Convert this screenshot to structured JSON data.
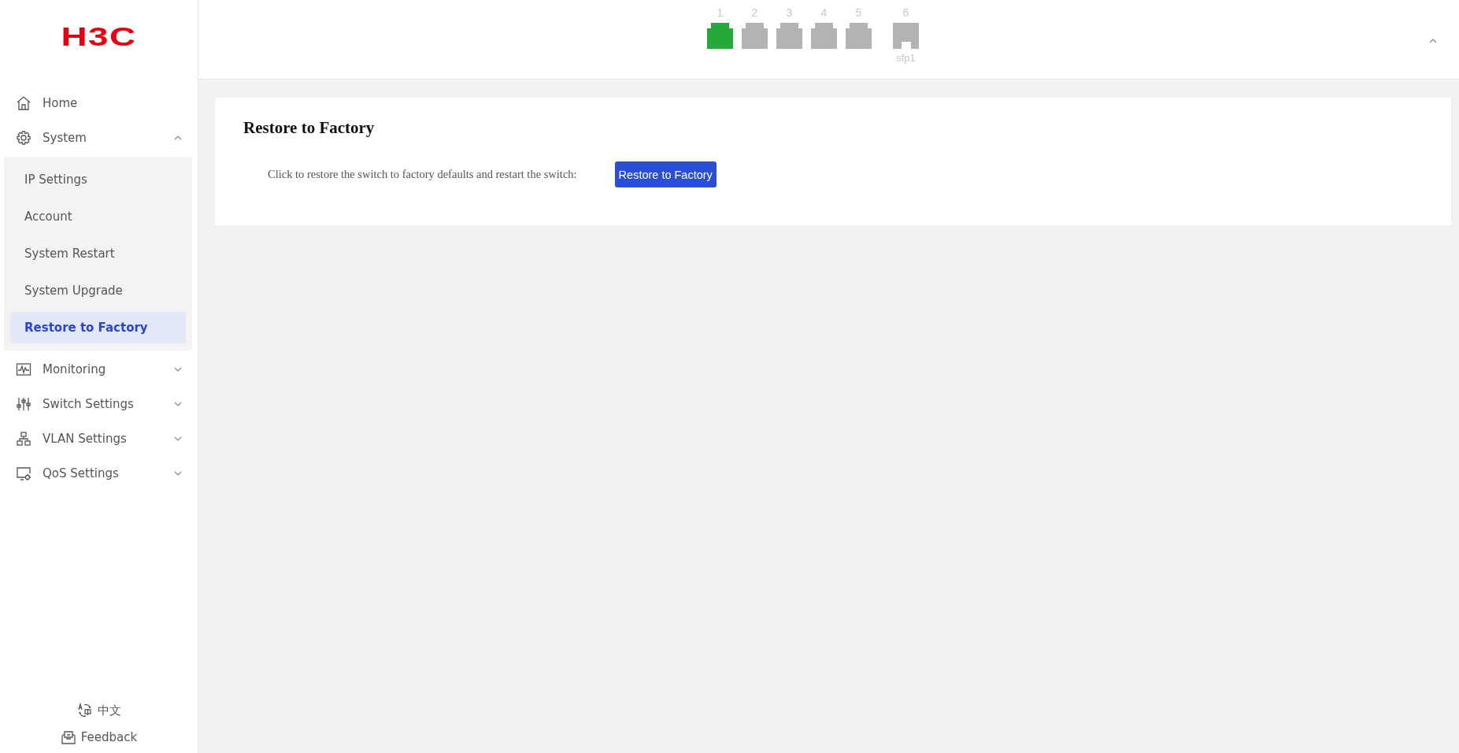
{
  "logo": {
    "text": "H3C"
  },
  "sidebar": {
    "items": [
      {
        "label": "Home",
        "kind": "link"
      },
      {
        "label": "System",
        "kind": "group",
        "expanded": true,
        "children": [
          {
            "label": "IP Settings",
            "selected": false
          },
          {
            "label": "Account",
            "selected": false
          },
          {
            "label": "System Restart",
            "selected": false
          },
          {
            "label": "System Upgrade",
            "selected": false
          },
          {
            "label": "Restore to Factory",
            "selected": true
          }
        ]
      },
      {
        "label": "Monitoring",
        "kind": "group",
        "expanded": false
      },
      {
        "label": "Switch Settings",
        "kind": "group",
        "expanded": false
      },
      {
        "label": "VLAN Settings",
        "kind": "group",
        "expanded": false
      },
      {
        "label": "QoS Settings",
        "kind": "group",
        "expanded": false
      }
    ],
    "footer": {
      "language": "中文",
      "feedback": "Feedback"
    }
  },
  "ports": [
    {
      "label": "1",
      "kind": "rj45",
      "linked": true
    },
    {
      "label": "2",
      "kind": "rj45",
      "linked": false
    },
    {
      "label": "3",
      "kind": "rj45",
      "linked": false
    },
    {
      "label": "4",
      "kind": "rj45",
      "linked": false
    },
    {
      "label": "5",
      "kind": "rj45",
      "linked": false
    },
    {
      "label": "6",
      "kind": "sfp",
      "linked": false,
      "caption": "sfp1"
    }
  ],
  "panel": {
    "title": "Restore to Factory",
    "description": "Click to restore the switch to factory defaults and restart the switch:",
    "button": "Restore to Factory"
  }
}
